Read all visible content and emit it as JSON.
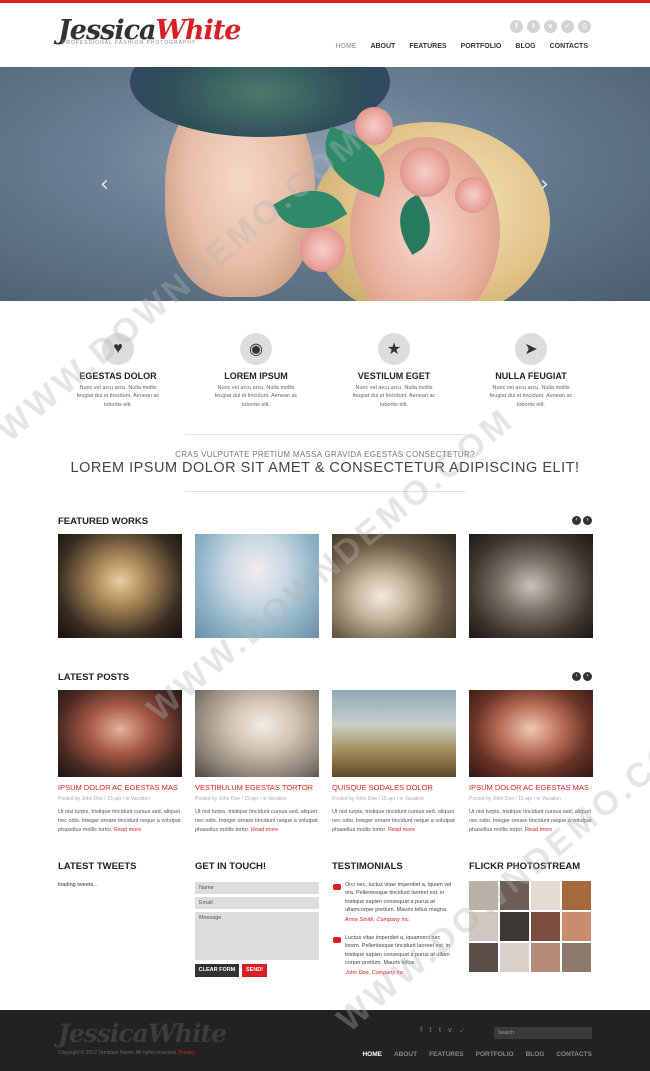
{
  "header": {
    "logo_part1": "Jessica",
    "logo_part2": "White",
    "tagline": "Professional fashion photography",
    "social_icons": [
      "facebook-icon",
      "twitter-icon",
      "vimeo-icon",
      "twitter-bird-icon",
      "rss-icon"
    ],
    "nav": [
      "HOME",
      "ABOUT",
      "FEATURES",
      "PORTFOLIO",
      "BLOG",
      "CONTACTS"
    ],
    "active_nav": "HOME"
  },
  "hero": {
    "prev": "‹",
    "next": "›"
  },
  "features": [
    {
      "icon": "heart-icon",
      "title": "EGESTAS DOLOR",
      "text": "Nunc vel arcu arcu. Nulla mollis feugiat dui et tincidunt. Aenean ac lobortis elit."
    },
    {
      "icon": "globe-icon",
      "title": "LOREM IPSUM",
      "text": "Nunc vel arcu arcu. Nulla mollis feugiat dui et tincidunt. Aenean ac lobortis elit."
    },
    {
      "icon": "star-icon",
      "title": "VESTILUM EGET",
      "text": "Nunc vel arcu arcu. Nulla mollis feugiat dui et tincidunt. Aenean ac lobortis elit."
    },
    {
      "icon": "send-icon",
      "title": "NULLA FEUGIAT",
      "text": "Nunc vel arcu arcu. Nulla mollis feugiat dui et tincidunt. Aenean ac lobortis elit."
    }
  ],
  "intro": {
    "sub": "CRAS VULPUTATE PRETIUM MASSA GRAVIDA EGESTAS CONSECTETUR?",
    "main": "LOREM IPSUM DOLOR SIT AMET & CONSECTETUR ADIPISCING ELIT!"
  },
  "featured": {
    "title": "FEATURED WORKS",
    "prev": "‹",
    "next": "›"
  },
  "posts": {
    "title": "LATEST POSTS",
    "prev": "‹",
    "next": "›",
    "items": [
      {
        "title": "IPSUM DOLOR AC EGESTAS MAS",
        "meta": "Posted by John Doe / 15 apr / in Vacation",
        "body": "Ut nisl turpis, tristique tincidunt cursus sed, aliquet nec odio. Integer ornare tincidunt neque a volutpat phasellus mollis tortor.",
        "more": "Read more"
      },
      {
        "title": "VESTIBULUM EGESTAS TORTOR",
        "meta": "Posted by John Doe / 15 apr / in Vacation",
        "body": "Ut nisl turpis, tristique tincidunt cursus sed, aliquet nec odio. Integer ornare tincidunt neque a volutpat phasellus mollis tortor.",
        "more": "Read more"
      },
      {
        "title": "QUISQUE SODALES DOLOR",
        "meta": "Posted by John Doe / 15 apr / in Vacation",
        "body": "Ut nisl turpis, tristique tincidunt cursus sed, aliquet nec odio. Integer ornare tincidunt neque a volutpat phasellus mollis tortor.",
        "more": "Read more"
      },
      {
        "title": "IPSUM DOLOR AC EGESTAS MAS",
        "meta": "Posted by John Doe / 15 apr / in Vacation",
        "body": "Ut nisl turpis, tristique tincidunt cursus sed, aliquet nec odio. Integer ornare tincidunt neque a volutpat phasellus mollis tortor.",
        "more": "Read more"
      }
    ]
  },
  "tweets": {
    "title": "LATEST TWEETS",
    "status": "loading tweets..."
  },
  "contact": {
    "title": "GET IN TOUCH!",
    "name_placeholder": "Name",
    "email_placeholder": "Email",
    "message_placeholder": "Message",
    "clear_label": "CLEAR FORM",
    "send_label": "SEND!"
  },
  "testimonials": {
    "title": "TESTIMONIALS",
    "items": [
      {
        "text": "Orci nec, luctus vitae imperdiet a, iquam vel ora. Pellentesque tincidunt laoreet est, in tristique sapien consequat a purus at ullamcorper pretium. Mauris tellus magna.",
        "author": "Anna Smith, Company inc."
      },
      {
        "text": "Luctus vitae imperdiet a, iquamorci nec lorem. Pellentesque tincidunt laoreet est, in tristique sapien consequat a purus at ullam corper pretium. Mauris tellus.",
        "author": "John Doe, Company inc."
      }
    ]
  },
  "flickr": {
    "title": "FLICKR PHOTOSTREAM"
  },
  "footer": {
    "logo_part1": "Jessica",
    "logo_part2": "White",
    "copyright": "Copyright © 2012 Template Name. All rights reserved.",
    "privacy": "Privacy",
    "social_icons": [
      "facebook-icon",
      "twitter-icon",
      "tumblr-icon",
      "vimeo-icon",
      "dribbble-icon"
    ],
    "search_placeholder": "Search",
    "nav": [
      "HOME",
      "ABOUT",
      "FEATURES",
      "PORTFOLIO",
      "BLOG",
      "CONTACTS"
    ]
  },
  "watermark": "WWW.DOWNDEMO.COM",
  "colors": {
    "accent": "#d81f26",
    "footer_bg": "#222222"
  }
}
